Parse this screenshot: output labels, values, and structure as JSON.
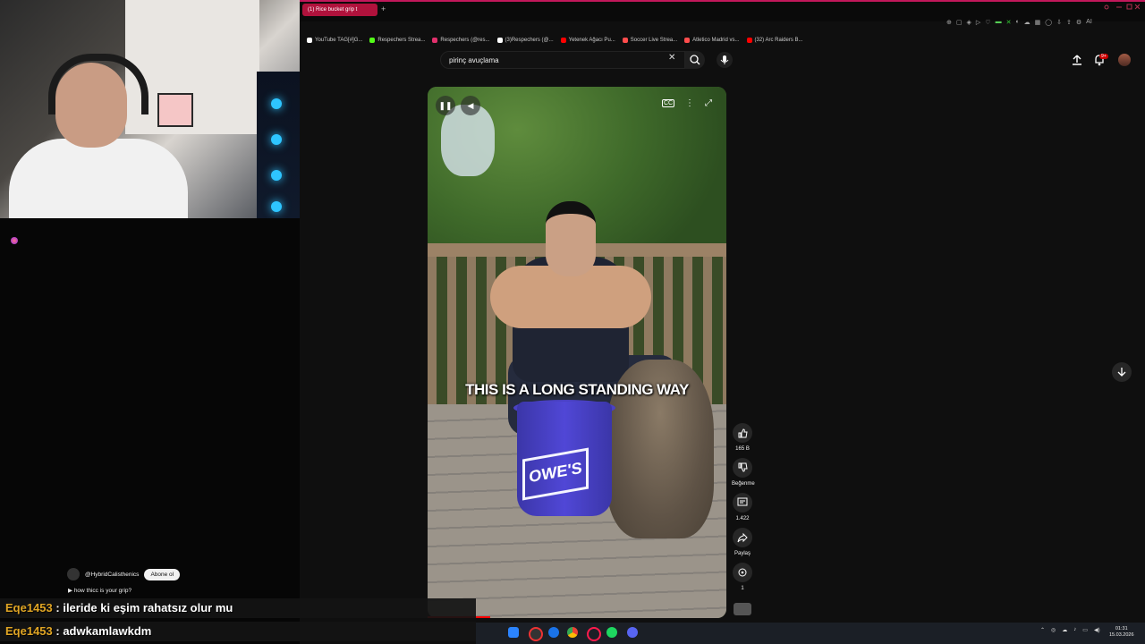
{
  "browser": {
    "active_tab_title": "(1) Rice bucket grip t",
    "new_tab_glyph": "+",
    "bookmarks": [
      {
        "label": "YouTube TAG[#]G...",
        "color": "#ffffff"
      },
      {
        "label": "Respechers Strea...",
        "color": "#53fc18"
      },
      {
        "label": "Respechers (@res...",
        "color": "#e1306c"
      },
      {
        "label": "(3)Respechers (@...",
        "color": "#ffffff"
      },
      {
        "label": "Yetenek Ağacı Pu...",
        "color": "#ff0000"
      },
      {
        "label": "Soccer Live Strea...",
        "color": "#ff4d4d"
      },
      {
        "label": "Atletico Madrid vs...",
        "color": "#ff4d4d"
      },
      {
        "label": "(32) Arc Raiders B...",
        "color": "#ff0000"
      }
    ],
    "toolbar_extra": "AI"
  },
  "youtube": {
    "search_value": "pirinç avuçlama",
    "notification_count": "9+",
    "caption": "THIS IS A LONG STANDING WAY",
    "bucket_text": "OWE'S",
    "actions": {
      "like_count": "165 B",
      "dislike_label": "Beğenme",
      "comment_count": "1.422",
      "share_label": "Paylaş",
      "remix_count": "1"
    },
    "channel_name": "@HybridCalisthenics",
    "subscribe_label": "Abone ol",
    "video_title": "how thicc is your grip?",
    "overlap_text": "ileride ki eşim rahatsız olur mu"
  },
  "chat": [
    {
      "user": "Eqe1453",
      "message": ": ileride ki eşim rahatsız olur mu"
    },
    {
      "user": "Eqe1453",
      "message": ": adwkamlawkdm"
    }
  ],
  "taskbar": {
    "time": "01:31",
    "date": "15.03.2026"
  },
  "colors": {
    "youtube_red": "#ff0000",
    "chat_username": "#e0a524",
    "tab_active": "#b0123c"
  }
}
